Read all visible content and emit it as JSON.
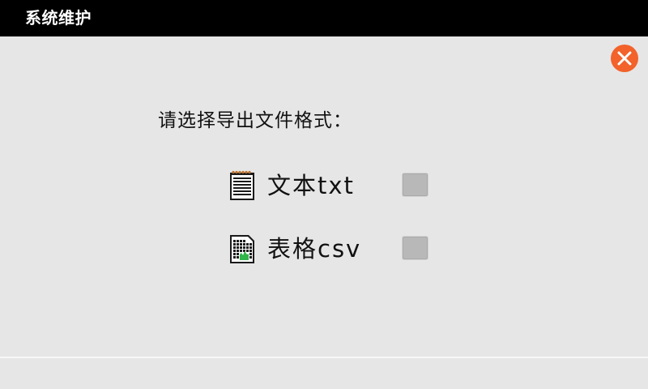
{
  "window": {
    "title": "系统维护"
  },
  "dialog": {
    "prompt": "请选择导出文件格式：",
    "options": [
      {
        "label": "文本txt",
        "icon": "notepad-icon",
        "checked": false
      },
      {
        "label": "表格csv",
        "icon": "spreadsheet-icon",
        "checked": false
      }
    ]
  },
  "colors": {
    "titlebar_bg": "#000000",
    "background": "#e6e6e6",
    "close_button": "#f2622a",
    "checkbox": "#b8b8b8"
  }
}
